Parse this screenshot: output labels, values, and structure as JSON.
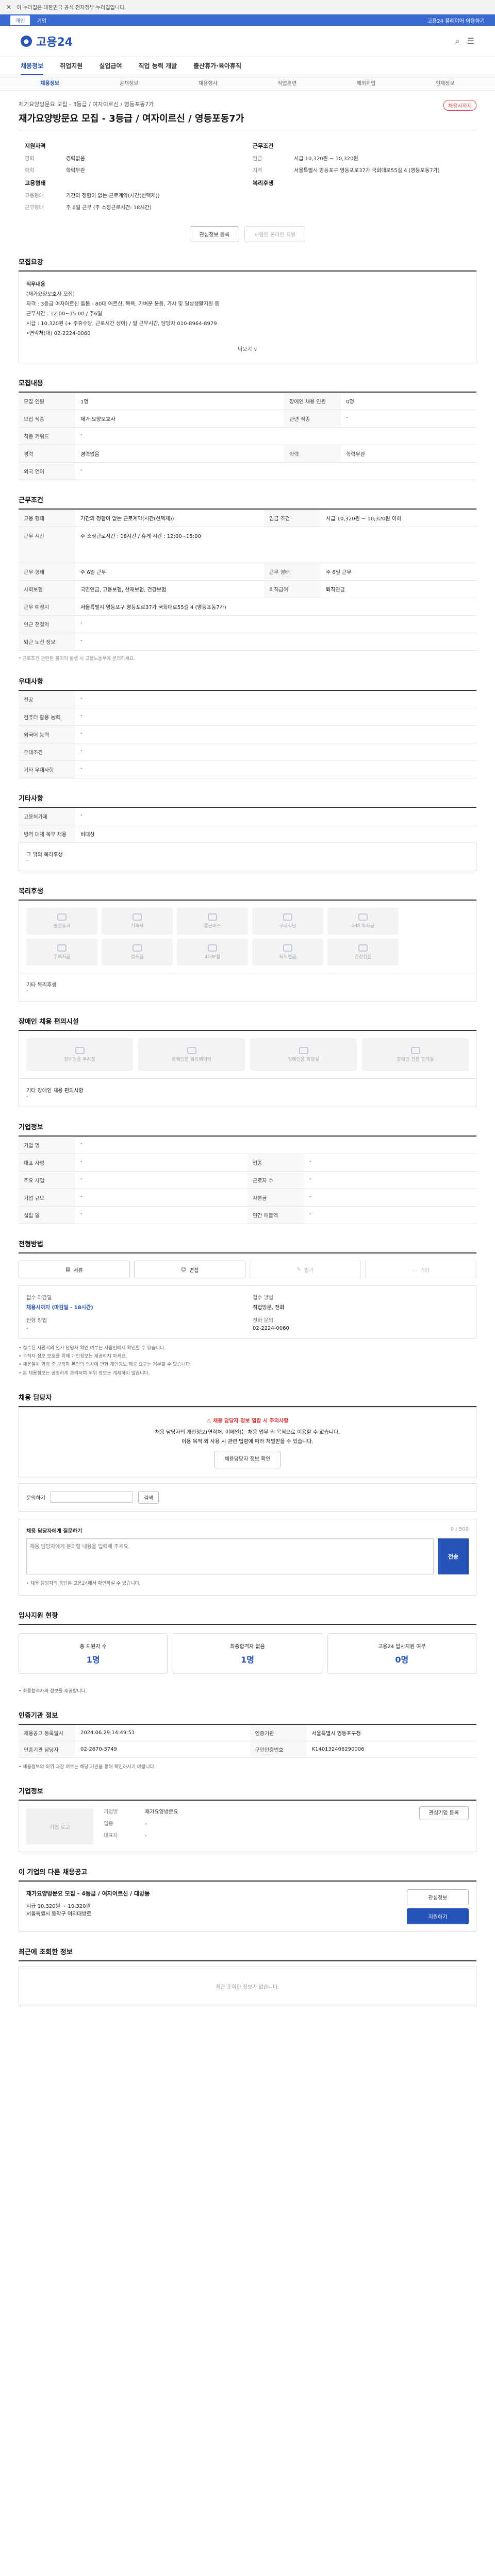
{
  "browser": {
    "notice": "이 누리집은 대한민국 공식 전자정부 누리집입니다."
  },
  "util": {
    "tab_personal": "개인",
    "tab_corp": "기업",
    "right": "고용24 플레이어 이용하기"
  },
  "brand": {
    "name": "고용24"
  },
  "gnb": [
    "채용정보",
    "취업지원",
    "실업급여",
    "직업 능력 개발",
    "출산휴가·육아휴직"
  ],
  "subnav": [
    "채용정보",
    "공채정보",
    "채용행사",
    "직업훈련",
    "해외취업",
    "인재정보"
  ],
  "job": {
    "company": "재기요양방문요 모집 - 3등급 / 여자이르신 / 영등포동7가",
    "title": "재가요양방문요 모집 - 3등급 / 여자이르신 / 영등포동7가",
    "badge": "채용시까지",
    "summary_left_title": "지원자격",
    "summary_right_title": "근무조건",
    "left": [
      {
        "k": "경력",
        "v": "경력없음"
      },
      {
        "k": "학력",
        "v": "학력무관"
      }
    ],
    "right": [
      {
        "k": "임금",
        "v": "시급 10,320원 ~ 10,320원"
      },
      {
        "k": "지역",
        "v": "서울특별시 영등포구 영등포로37가 국회대로55길 4 (영등포동7가)"
      }
    ],
    "left2_title": "고용형태",
    "right2_title": "복리후생",
    "left2": [
      {
        "k": "고용형태",
        "v": "기간의 정함이 없는 근로계약(시간(선택제))"
      },
      {
        "k": "근무형태",
        "v": "주 6일 근무 (주 소정근로시간: 18시간)"
      }
    ]
  },
  "buttons": {
    "save": "관심정보 등록",
    "apply": "사람인 온라인 지원"
  },
  "detail": {
    "title": "모집요강",
    "lines": [
      "직무내용",
      "[재가요양보호사 모집]",
      "자격 : 3등급 여자어르신 돌봄 - 80대 어르신, 목욕, 가벼운 운동, 가사 및 일상생활지원 등",
      "근무시간 : 12:00~15:00 / 주6일",
      "시급 : 10,320원 (+ 주휴수당, 근로시간 상이) / 일 근무시간, 담당자 010-8964-8979",
      "•연락처(대) 02-2224-0060"
    ],
    "more": "더보기 ∨"
  },
  "recruit": {
    "rows": [
      {
        "k": "모집 인원",
        "v": "1명",
        "k2": "장애인 채용 인원",
        "v2": "0명"
      },
      {
        "k": "모집 직종",
        "v": "재가 요양보호사",
        "k2": "관련 직종",
        "v2": "-"
      },
      {
        "k": "직종 키워드",
        "v": "-",
        "k2": "",
        "v2": ""
      },
      {
        "k": "경력",
        "v": "경력없음",
        "k2": "학력",
        "v2": "학력무관"
      },
      {
        "k": "외국 언어",
        "v": "-",
        "k2": "",
        "v2": ""
      }
    ],
    "title": "모집내용"
  },
  "work": {
    "title": "근무조건",
    "rows": [
      {
        "k": "고용 형태",
        "v": "기간의 정함이 없는 근로계약(시간(선택제))",
        "k2": "임금 조건",
        "v2": "시급 10,320원 ~ 10,320원 이하"
      },
      {
        "k": "근무 시간",
        "v": "주 소정근로시간 : 18시간 / 휴게 시간 : 12:00~15:00",
        "k2": "",
        "v2": ""
      },
      {
        "k": "근무 형태",
        "v": "주 6일 근무",
        "k2": "근무 형태",
        "v2": "주 6일 근무"
      },
      {
        "k": "사회보험",
        "v": "국민연금, 고용보험, 산재보험, 건강보험",
        "k2": "퇴직급여",
        "v2": "퇴직연금"
      },
      {
        "k": "근무 예정지",
        "v": "서울특별시 영등포구 영등포로37가 국회대로55길 4 (영등포동7가)",
        "k2": "",
        "v2": ""
      },
      {
        "k": "인근 전철역",
        "v": "-",
        "k2": "",
        "v2": ""
      },
      {
        "k": "퇴근 노선 정보",
        "v": "-",
        "k2": "",
        "v2": ""
      }
    ],
    "note": "* 근로조건 관련된 불이익 발생 시 고용노동부에 문의하세요."
  },
  "prefer": {
    "title": "우대사항",
    "rows": [
      {
        "k": "전공",
        "v": "-"
      },
      {
        "k": "컴퓨터 활용 능력",
        "v": "-"
      },
      {
        "k": "외국어 능력",
        "v": "-"
      },
      {
        "k": "우대조건",
        "v": "-"
      },
      {
        "k": "기타 우대사항",
        "v": "-"
      }
    ]
  },
  "etc": {
    "title": "기타사항",
    "rows": [
      {
        "k": "고용허가제",
        "v": "-"
      },
      {
        "k": "병역 대체 복무 채용",
        "v": "비대상"
      }
    ],
    "extra_label": "그 밖의 복리후생",
    "extra_val": "-"
  },
  "welfare": {
    "title": "복리후생",
    "items": [
      "출산휴가",
      "기숙사",
      "통근버스",
      "구내식당",
      "자녀 학자금",
      "주택자금",
      "경조금",
      "4대보험",
      "퇴직연금",
      "건강검진"
    ],
    "note_label": "기타 복리후생",
    "note_val": "-"
  },
  "disabled": {
    "title": "장애인 채용 편의시설",
    "items": [
      "장애인용 주차장",
      "장애인용 엘리베이터",
      "장애인용 화장실",
      "장애인 전용 휴게실"
    ],
    "note_label": "기타 장애인 채용 편의사항",
    "note_val": "-"
  },
  "company_info": {
    "title": "기업정보",
    "rows": [
      {
        "k": "기업 명",
        "v": "-",
        "k2": "",
        "v2": ""
      },
      {
        "k": "대표 자명",
        "v": "-",
        "k2": "업종",
        "v2": "-"
      },
      {
        "k": "주요 사업",
        "v": "-",
        "k2": "근로자 수",
        "v2": "-"
      },
      {
        "k": "기업 규모",
        "v": "-",
        "k2": "자본금",
        "v2": "-"
      },
      {
        "k": "설립 일",
        "v": "-",
        "k2": "연간 매출액",
        "v2": "-"
      }
    ]
  },
  "process": {
    "title": "전형방법",
    "steps": [
      "서류",
      "면접",
      "필기",
      "기타"
    ]
  },
  "contact": {
    "t1": "접수 마감일",
    "v1": "채용시까지 (마감일 - 18시간)",
    "t2": "접수 방법",
    "v2": "직접방문, 전화",
    "t3": "전형 방법",
    "v3": "-",
    "t4": "전화 문의",
    "v4": "02-2224-0060"
  },
  "bullets": [
    "• 접수된 지원서의 인사 담당자 확인 여부는 사람인에서 확인할 수 있습니다.",
    "• 구직자 정보 보호를 위해 개인정보는 제공하지 마세요.",
    "• 채용절차 과정 중 구직자 본인의 의사에 반한 개인정보 제공 요구는 거부할 수 있습니다.",
    "• 본 채용정보는 공정하게 관리되며 허위 정보는 게재하지 않습니다."
  ],
  "manager": {
    "title": "채용 담당자",
    "warn_head": "채용 담당자 정보 열람 시 주의사항",
    "warn_lines": [
      "채용 담당자의 개인정보(연락처, 이메일)는 채용 업무 외 목적으로 이용할 수 없습니다.",
      "이용 목적 외 사용 시 관련 법령에 따라 처벌받을 수 있습니다."
    ],
    "view_btn": "채용담당자 정보 확인",
    "qa_label": "문의하기",
    "qa_input": "",
    "qa_btn": "검색"
  },
  "message": {
    "title": "채용 담당자에게 질문하기",
    "counter": "0 / 500",
    "placeholder": "채용 담당자에게 문의할 내용을 입력해 주세요.",
    "send": "전송",
    "footnote": "• 채용 담당자의 응답은 고용24에서 확인하실 수 있습니다."
  },
  "apply_stats": {
    "title": "입사지원 현황",
    "items": [
      {
        "label": "총 지원자 수",
        "num": "1명"
      },
      {
        "label": "최종합격자 없음",
        "num": "1명"
      },
      {
        "label": "고용24 입사지원 여부",
        "num": "0명"
      }
    ],
    "note": "• 최종합격자의 정보를 제공합니다."
  },
  "info": {
    "title": "인증기관 정보",
    "rows": [
      {
        "k": "채용공고 등록일시",
        "v": "2024.06.29 14:49:51",
        "k2": "인증기관",
        "v2": "서울특별시 영등포구청"
      },
      {
        "k": "인증기관 담당자",
        "v": "02-2670-3749",
        "k2": "구인인증번호",
        "v2": "K140132406290006"
      }
    ],
    "note": "• 채용정보의 허위·과장 여부는 해당 기관을 통해 확인하시기 바랍니다."
  },
  "corp_card": {
    "title": "기업정보",
    "logo": "기업 로고",
    "rows": [
      {
        "k": "기업명",
        "v": "재가요양방문요"
      },
      {
        "k": "업종",
        "v": "-"
      },
      {
        "k": "대표자",
        "v": "-"
      }
    ],
    "btn": "관심기업 등록"
  },
  "other": {
    "title": "이 기업의 다른 채용공고",
    "job": "재가요양방문요 모집 - 4등급 / 여자어르신 / 대방동",
    "wage": "시급 10,320원 ~ 10,320원",
    "loc": "서울특별시 동작구 여의대방로",
    "btns": [
      "관심정보",
      "지원하기"
    ]
  },
  "recent": {
    "title": "최근에 조회한 정보",
    "empty": "최근 조회한 정보가 없습니다."
  }
}
